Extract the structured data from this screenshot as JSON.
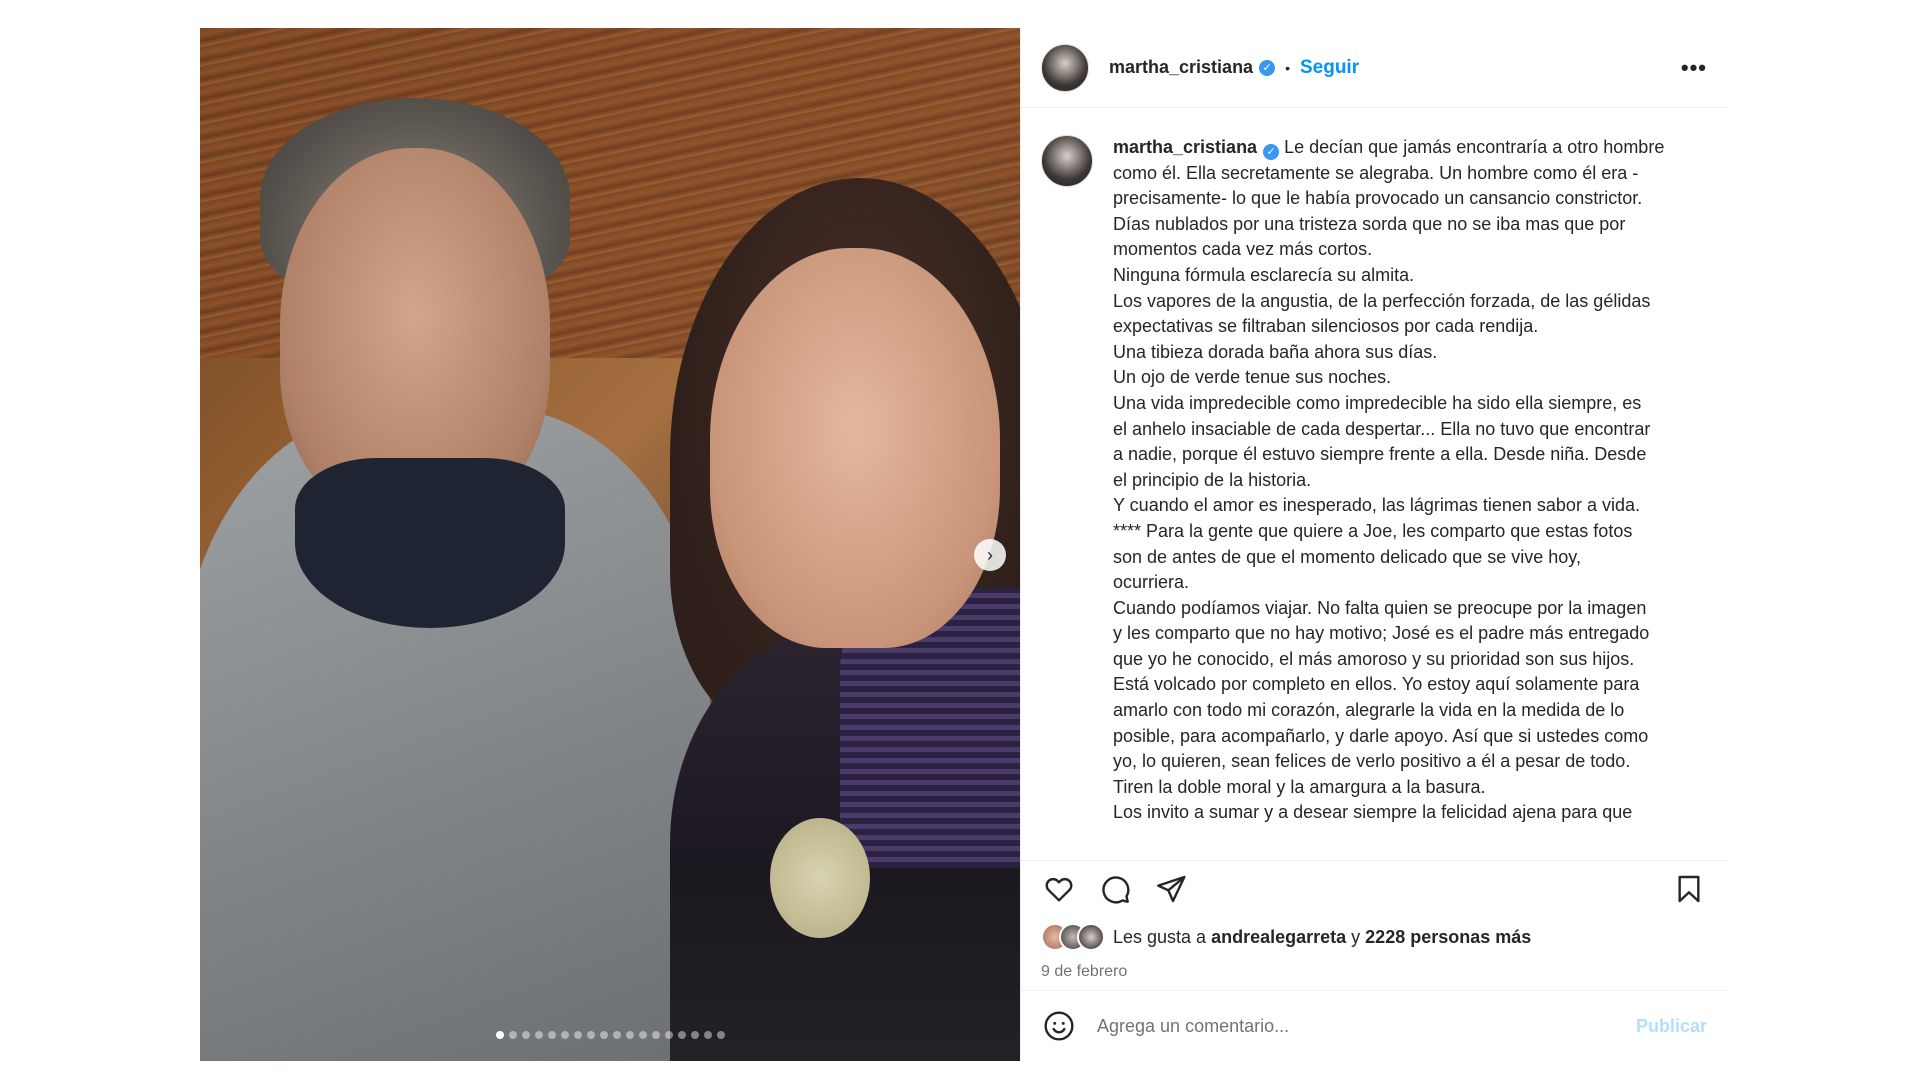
{
  "post": {
    "author": {
      "username": "martha_cristiana",
      "verified_mark": "✓"
    },
    "follow_label": "Seguir",
    "separator": "•",
    "more_label": "•••",
    "caption": {
      "username": "martha_cristiana",
      "lines": [
        "Le decían que jamás encontraría a otro hombre",
        "como él. Ella secretamente se alegraba. Un hombre como él era -",
        "precisamente- lo que le había provocado un cansancio constrictor.",
        "Días nublados por una tristeza sorda que no se iba mas que por",
        "momentos cada vez más cortos.",
        "Ninguna fórmula esclarecía su almita.",
        "Los vapores de la angustia, de la perfección forzada, de las gélidas",
        "expectativas se filtraban silenciosos por cada rendija.",
        "Una tibieza dorada baña ahora sus días.",
        "Un ojo de verde tenue sus noches.",
        "Una vida impredecible como impredecible ha sido ella siempre, es",
        "el anhelo insaciable de cada despertar... Ella no tuvo que encontrar",
        "a nadie, porque él estuvo siempre frente a ella. Desde niña. Desde",
        "el principio de la historia.",
        "Y cuando el amor es inesperado, las lágrimas tienen sabor a vida.",
        "**** Para la gente que quiere a Joe, les comparto que estas fotos",
        "son de antes de que el momento delicado que se vive hoy,",
        "ocurriera.",
        "Cuando podíamos viajar. No falta quien se preocupe por la imagen",
        "y les comparto que no hay motivo; José es el padre más entregado",
        "que yo he conocido, el más amoroso y su prioridad son sus hijos.",
        "Está volcado por completo en ellos. Yo estoy aquí solamente para",
        "amarlo con todo mi corazón, alegrarle la vida en la medida de lo",
        "posible, para acompañarlo, y darle apoyo. Así que si ustedes como",
        "yo, lo quieren, sean felices de verlo positivo a él a pesar de todo.",
        "Tiren la doble moral y la amargura a la basura.",
        "Los invito a sumar y a desear siempre la felicidad ajena para que"
      ]
    },
    "likes": {
      "prefix": "Les gusta a ",
      "user": "andrealegarreta",
      "middle": " y ",
      "count": "2228 personas más"
    },
    "date": "9 de febrero",
    "comment": {
      "placeholder": "Agrega un comentario...",
      "publish_label": "Publicar"
    },
    "carousel": {
      "total": 18,
      "active_index": 0,
      "next_glyph": "›"
    },
    "icons": {
      "like": "heart-icon",
      "comment": "comment-bubble-icon",
      "share": "paper-plane-icon",
      "save": "bookmark-icon",
      "emoji": "smiley-icon"
    }
  }
}
